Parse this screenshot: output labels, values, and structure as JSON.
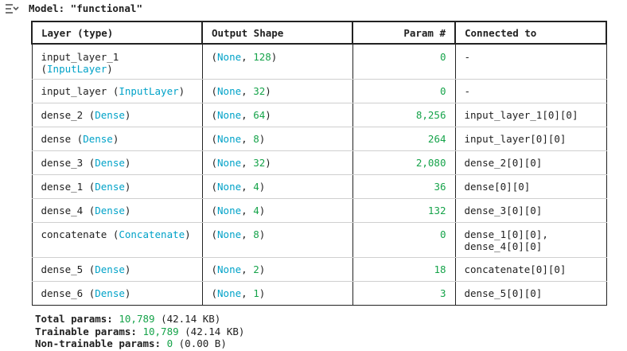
{
  "header": {
    "model_label": "Model: \"functional\"",
    "icon": "output-expand-icon"
  },
  "table": {
    "columns": [
      "Layer (type)",
      "Output Shape",
      "Param #",
      "Connected to"
    ],
    "rows": [
      {
        "name": "input_layer_1",
        "type": "InputLayer",
        "shape_none": "None",
        "shape_dim": "128",
        "params": "0",
        "connected": [
          "-"
        ]
      },
      {
        "name": "input_layer",
        "type": "InputLayer",
        "shape_none": "None",
        "shape_dim": "32",
        "params": "0",
        "connected": [
          "-"
        ]
      },
      {
        "name": "dense_2",
        "type": "Dense",
        "shape_none": "None",
        "shape_dim": "64",
        "params": "8,256",
        "connected": [
          "input_layer_1[0][0]"
        ]
      },
      {
        "name": "dense",
        "type": "Dense",
        "shape_none": "None",
        "shape_dim": "8",
        "params": "264",
        "connected": [
          "input_layer[0][0]"
        ]
      },
      {
        "name": "dense_3",
        "type": "Dense",
        "shape_none": "None",
        "shape_dim": "32",
        "params": "2,080",
        "connected": [
          "dense_2[0][0]"
        ]
      },
      {
        "name": "dense_1",
        "type": "Dense",
        "shape_none": "None",
        "shape_dim": "4",
        "params": "36",
        "connected": [
          "dense[0][0]"
        ]
      },
      {
        "name": "dense_4",
        "type": "Dense",
        "shape_none": "None",
        "shape_dim": "4",
        "params": "132",
        "connected": [
          "dense_3[0][0]"
        ]
      },
      {
        "name": "concatenate",
        "type": "Concatenate",
        "shape_none": "None",
        "shape_dim": "8",
        "params": "0",
        "connected": [
          "dense_1[0][0],",
          "dense_4[0][0]"
        ]
      },
      {
        "name": "dense_5",
        "type": "Dense",
        "shape_none": "None",
        "shape_dim": "2",
        "params": "18",
        "connected": [
          "concatenate[0][0]"
        ]
      },
      {
        "name": "dense_6",
        "type": "Dense",
        "shape_none": "None",
        "shape_dim": "1",
        "params": "3",
        "connected": [
          "dense_5[0][0]"
        ]
      }
    ]
  },
  "summary": {
    "total_label": "Total params:",
    "total_value": "10,789",
    "total_size": "(42.14 KB)",
    "trainable_label": "Trainable params:",
    "trainable_value": "10,789",
    "trainable_size": "(42.14 KB)",
    "non_trainable_label": "Non-trainable params:",
    "non_trainable_value": "0",
    "non_trainable_size": "(0.00 B)"
  },
  "colors": {
    "class_name": "#00a2c8",
    "number": "#16a34a",
    "border": "#222222"
  }
}
